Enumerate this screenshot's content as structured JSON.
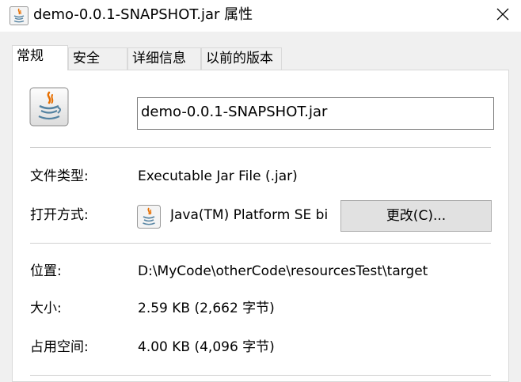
{
  "window": {
    "title": "demo-0.0.1-SNAPSHOT.jar 属性",
    "close_icon": "close-icon"
  },
  "tabs": [
    {
      "label": "常规",
      "active": true
    },
    {
      "label": "安全",
      "active": false
    },
    {
      "label": "详细信息",
      "active": false
    },
    {
      "label": "以前的版本",
      "active": false
    }
  ],
  "general": {
    "file_icon": "java-jar-icon",
    "file_name": "demo-0.0.1-SNAPSHOT.jar",
    "file_type_label": "文件类型:",
    "file_type_value": "Executable Jar File (.jar)",
    "open_with_label": "打开方式:",
    "open_with_icon": "java-icon",
    "open_with_value": "Java(TM) Platform SE bi",
    "change_button": "更改(C)...",
    "location_label": "位置:",
    "location_value": "D:\\MyCode\\otherCode\\resourcesTest\\target",
    "size_label": "大小:",
    "size_value": "2.59 KB (2,662 字节)",
    "disk_size_label": "占用空间:",
    "disk_size_value": "4.00 KB (4,096 字节)"
  },
  "colors": {
    "title_bar": "#ffffff",
    "window_bg": "#f0f0f0",
    "panel_bg": "#ffffff",
    "button_bg": "#e1e1e1",
    "java_red": "#e76f00",
    "java_blue": "#5382a1"
  }
}
